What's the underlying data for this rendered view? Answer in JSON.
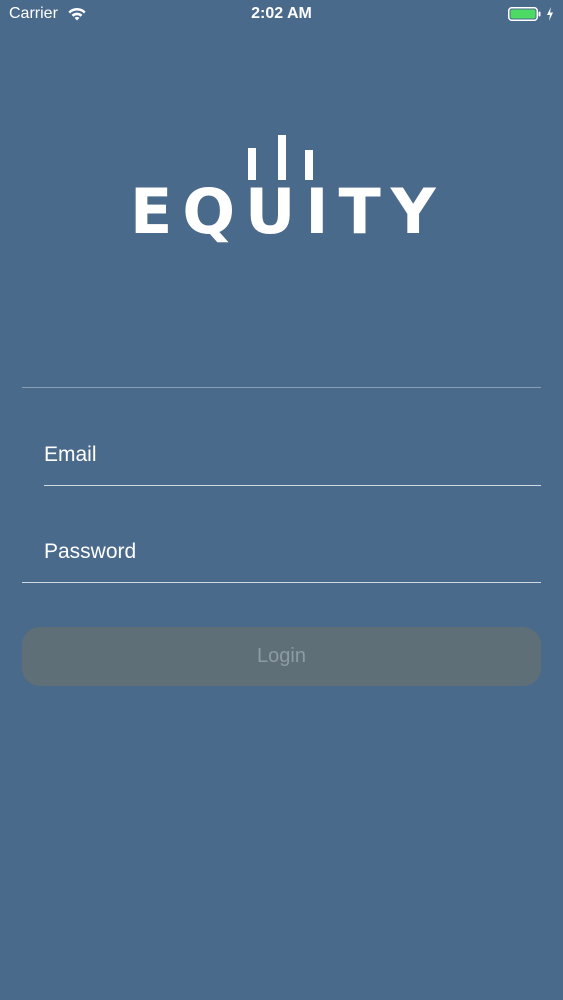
{
  "status_bar": {
    "carrier": "Carrier",
    "time": "2:02 AM",
    "wifi_icon": "wifi-icon",
    "battery_icon": "battery-icon",
    "battery_color": "#4cd964"
  },
  "logo": {
    "text": "EQUITY"
  },
  "form": {
    "email_placeholder": "Email",
    "password_placeholder": "Password",
    "login_label": "Login"
  },
  "colors": {
    "background": "#4a6a8c",
    "button_background": "#5f6f77",
    "button_text": "#8e9ba3"
  }
}
